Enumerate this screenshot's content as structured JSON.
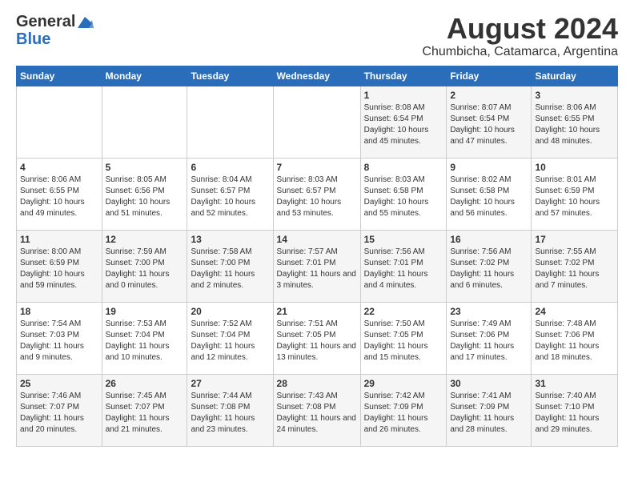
{
  "header": {
    "logo_general": "General",
    "logo_blue": "Blue",
    "title": "August 2024",
    "subtitle": "Chumbicha, Catamarca, Argentina"
  },
  "calendar": {
    "days_of_week": [
      "Sunday",
      "Monday",
      "Tuesday",
      "Wednesday",
      "Thursday",
      "Friday",
      "Saturday"
    ],
    "weeks": [
      [
        {
          "day": "",
          "info": ""
        },
        {
          "day": "",
          "info": ""
        },
        {
          "day": "",
          "info": ""
        },
        {
          "day": "",
          "info": ""
        },
        {
          "day": "1",
          "info": "Sunrise: 8:08 AM\nSunset: 6:54 PM\nDaylight: 10 hours and 45 minutes."
        },
        {
          "day": "2",
          "info": "Sunrise: 8:07 AM\nSunset: 6:54 PM\nDaylight: 10 hours and 47 minutes."
        },
        {
          "day": "3",
          "info": "Sunrise: 8:06 AM\nSunset: 6:55 PM\nDaylight: 10 hours and 48 minutes."
        }
      ],
      [
        {
          "day": "4",
          "info": "Sunrise: 8:06 AM\nSunset: 6:55 PM\nDaylight: 10 hours and 49 minutes."
        },
        {
          "day": "5",
          "info": "Sunrise: 8:05 AM\nSunset: 6:56 PM\nDaylight: 10 hours and 51 minutes."
        },
        {
          "day": "6",
          "info": "Sunrise: 8:04 AM\nSunset: 6:57 PM\nDaylight: 10 hours and 52 minutes."
        },
        {
          "day": "7",
          "info": "Sunrise: 8:03 AM\nSunset: 6:57 PM\nDaylight: 10 hours and 53 minutes."
        },
        {
          "day": "8",
          "info": "Sunrise: 8:03 AM\nSunset: 6:58 PM\nDaylight: 10 hours and 55 minutes."
        },
        {
          "day": "9",
          "info": "Sunrise: 8:02 AM\nSunset: 6:58 PM\nDaylight: 10 hours and 56 minutes."
        },
        {
          "day": "10",
          "info": "Sunrise: 8:01 AM\nSunset: 6:59 PM\nDaylight: 10 hours and 57 minutes."
        }
      ],
      [
        {
          "day": "11",
          "info": "Sunrise: 8:00 AM\nSunset: 6:59 PM\nDaylight: 10 hours and 59 minutes."
        },
        {
          "day": "12",
          "info": "Sunrise: 7:59 AM\nSunset: 7:00 PM\nDaylight: 11 hours and 0 minutes."
        },
        {
          "day": "13",
          "info": "Sunrise: 7:58 AM\nSunset: 7:00 PM\nDaylight: 11 hours and 2 minutes."
        },
        {
          "day": "14",
          "info": "Sunrise: 7:57 AM\nSunset: 7:01 PM\nDaylight: 11 hours and 3 minutes."
        },
        {
          "day": "15",
          "info": "Sunrise: 7:56 AM\nSunset: 7:01 PM\nDaylight: 11 hours and 4 minutes."
        },
        {
          "day": "16",
          "info": "Sunrise: 7:56 AM\nSunset: 7:02 PM\nDaylight: 11 hours and 6 minutes."
        },
        {
          "day": "17",
          "info": "Sunrise: 7:55 AM\nSunset: 7:02 PM\nDaylight: 11 hours and 7 minutes."
        }
      ],
      [
        {
          "day": "18",
          "info": "Sunrise: 7:54 AM\nSunset: 7:03 PM\nDaylight: 11 hours and 9 minutes."
        },
        {
          "day": "19",
          "info": "Sunrise: 7:53 AM\nSunset: 7:04 PM\nDaylight: 11 hours and 10 minutes."
        },
        {
          "day": "20",
          "info": "Sunrise: 7:52 AM\nSunset: 7:04 PM\nDaylight: 11 hours and 12 minutes."
        },
        {
          "day": "21",
          "info": "Sunrise: 7:51 AM\nSunset: 7:05 PM\nDaylight: 11 hours and 13 minutes."
        },
        {
          "day": "22",
          "info": "Sunrise: 7:50 AM\nSunset: 7:05 PM\nDaylight: 11 hours and 15 minutes."
        },
        {
          "day": "23",
          "info": "Sunrise: 7:49 AM\nSunset: 7:06 PM\nDaylight: 11 hours and 17 minutes."
        },
        {
          "day": "24",
          "info": "Sunrise: 7:48 AM\nSunset: 7:06 PM\nDaylight: 11 hours and 18 minutes."
        }
      ],
      [
        {
          "day": "25",
          "info": "Sunrise: 7:46 AM\nSunset: 7:07 PM\nDaylight: 11 hours and 20 minutes."
        },
        {
          "day": "26",
          "info": "Sunrise: 7:45 AM\nSunset: 7:07 PM\nDaylight: 11 hours and 21 minutes."
        },
        {
          "day": "27",
          "info": "Sunrise: 7:44 AM\nSunset: 7:08 PM\nDaylight: 11 hours and 23 minutes."
        },
        {
          "day": "28",
          "info": "Sunrise: 7:43 AM\nSunset: 7:08 PM\nDaylight: 11 hours and 24 minutes."
        },
        {
          "day": "29",
          "info": "Sunrise: 7:42 AM\nSunset: 7:09 PM\nDaylight: 11 hours and 26 minutes."
        },
        {
          "day": "30",
          "info": "Sunrise: 7:41 AM\nSunset: 7:09 PM\nDaylight: 11 hours and 28 minutes."
        },
        {
          "day": "31",
          "info": "Sunrise: 7:40 AM\nSunset: 7:10 PM\nDaylight: 11 hours and 29 minutes."
        }
      ]
    ]
  }
}
